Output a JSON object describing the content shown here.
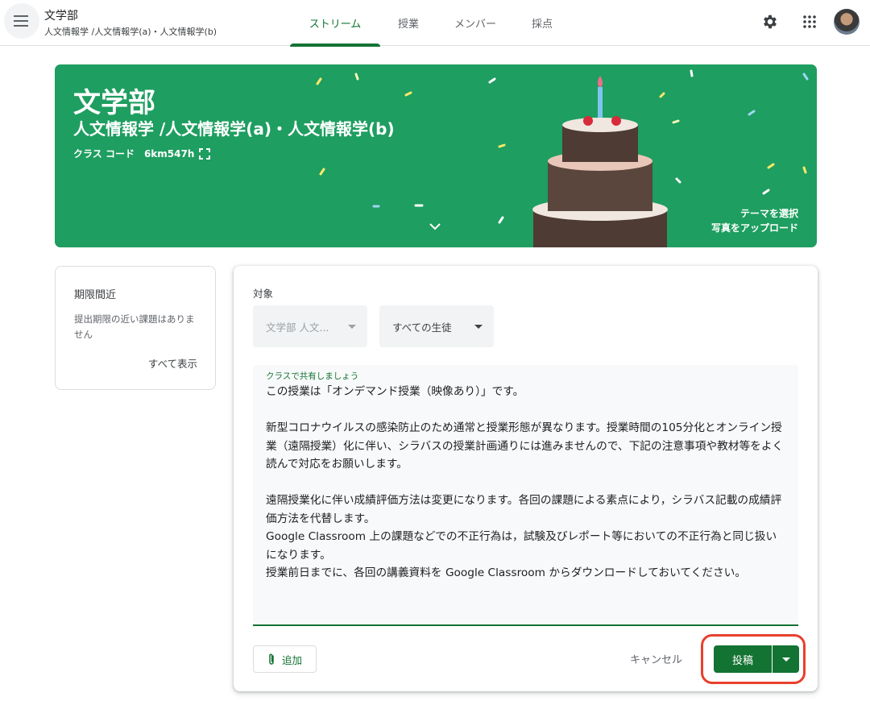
{
  "header": {
    "class_name": "文学部",
    "class_section": "人文情報学 /人文情報学(a)・人文情報学(b)",
    "tabs": [
      {
        "label": "ストリーム",
        "active": true
      },
      {
        "label": "授業"
      },
      {
        "label": "メンバー"
      },
      {
        "label": "採点"
      }
    ],
    "icons": [
      "menu-icon",
      "gear-icon",
      "apps-grid-icon",
      "avatar"
    ]
  },
  "banner": {
    "title": "文学部",
    "subtitle": "人文情報学 /人文情報学(a)・人文情報学(b)",
    "class_code_label": "クラス コード",
    "class_code": "6km547h",
    "select_theme": "テーマを選択",
    "upload_photo": "写真をアップロード",
    "background_color": "#1e9e60"
  },
  "upcoming": {
    "title": "期限間近",
    "body": "提出期限の近い課題はありません",
    "view_all": "すべて表示"
  },
  "composer": {
    "for_label": "対象",
    "class_select": "文学部 人文...",
    "students_select": "すべての生徒",
    "textarea_label": "クラスで共有しましょう",
    "textarea_value": "この授業は「オンデマンド授業（映像あり）」です。\n\n新型コロナウイルスの感染防止のため通常と授業形態が異なります。授業時間の105分化とオンライン授業（遠隔授業）化に伴い、シラバスの授業計画通りには進みませんので、下記の注意事項や教材等をよく読んで対応をお願いします。\n\n遠隔授業化に伴い成績評価方法は変更になります。各回の課題による素点により，シラバス記載の成績評価方法を代替します。\nGoogle Classroom 上の課題などでの不正行為は，試験及びレポート等においての不正行為と同じ扱いになります。\n授業前日までに、各回の講義資料を Google Classroom からダウンロードしておいてください。",
    "add_label": "追加",
    "cancel_label": "キャンセル",
    "post_label": "投稿",
    "accent_color": "#137333",
    "highlight_color": "#e8402d"
  }
}
